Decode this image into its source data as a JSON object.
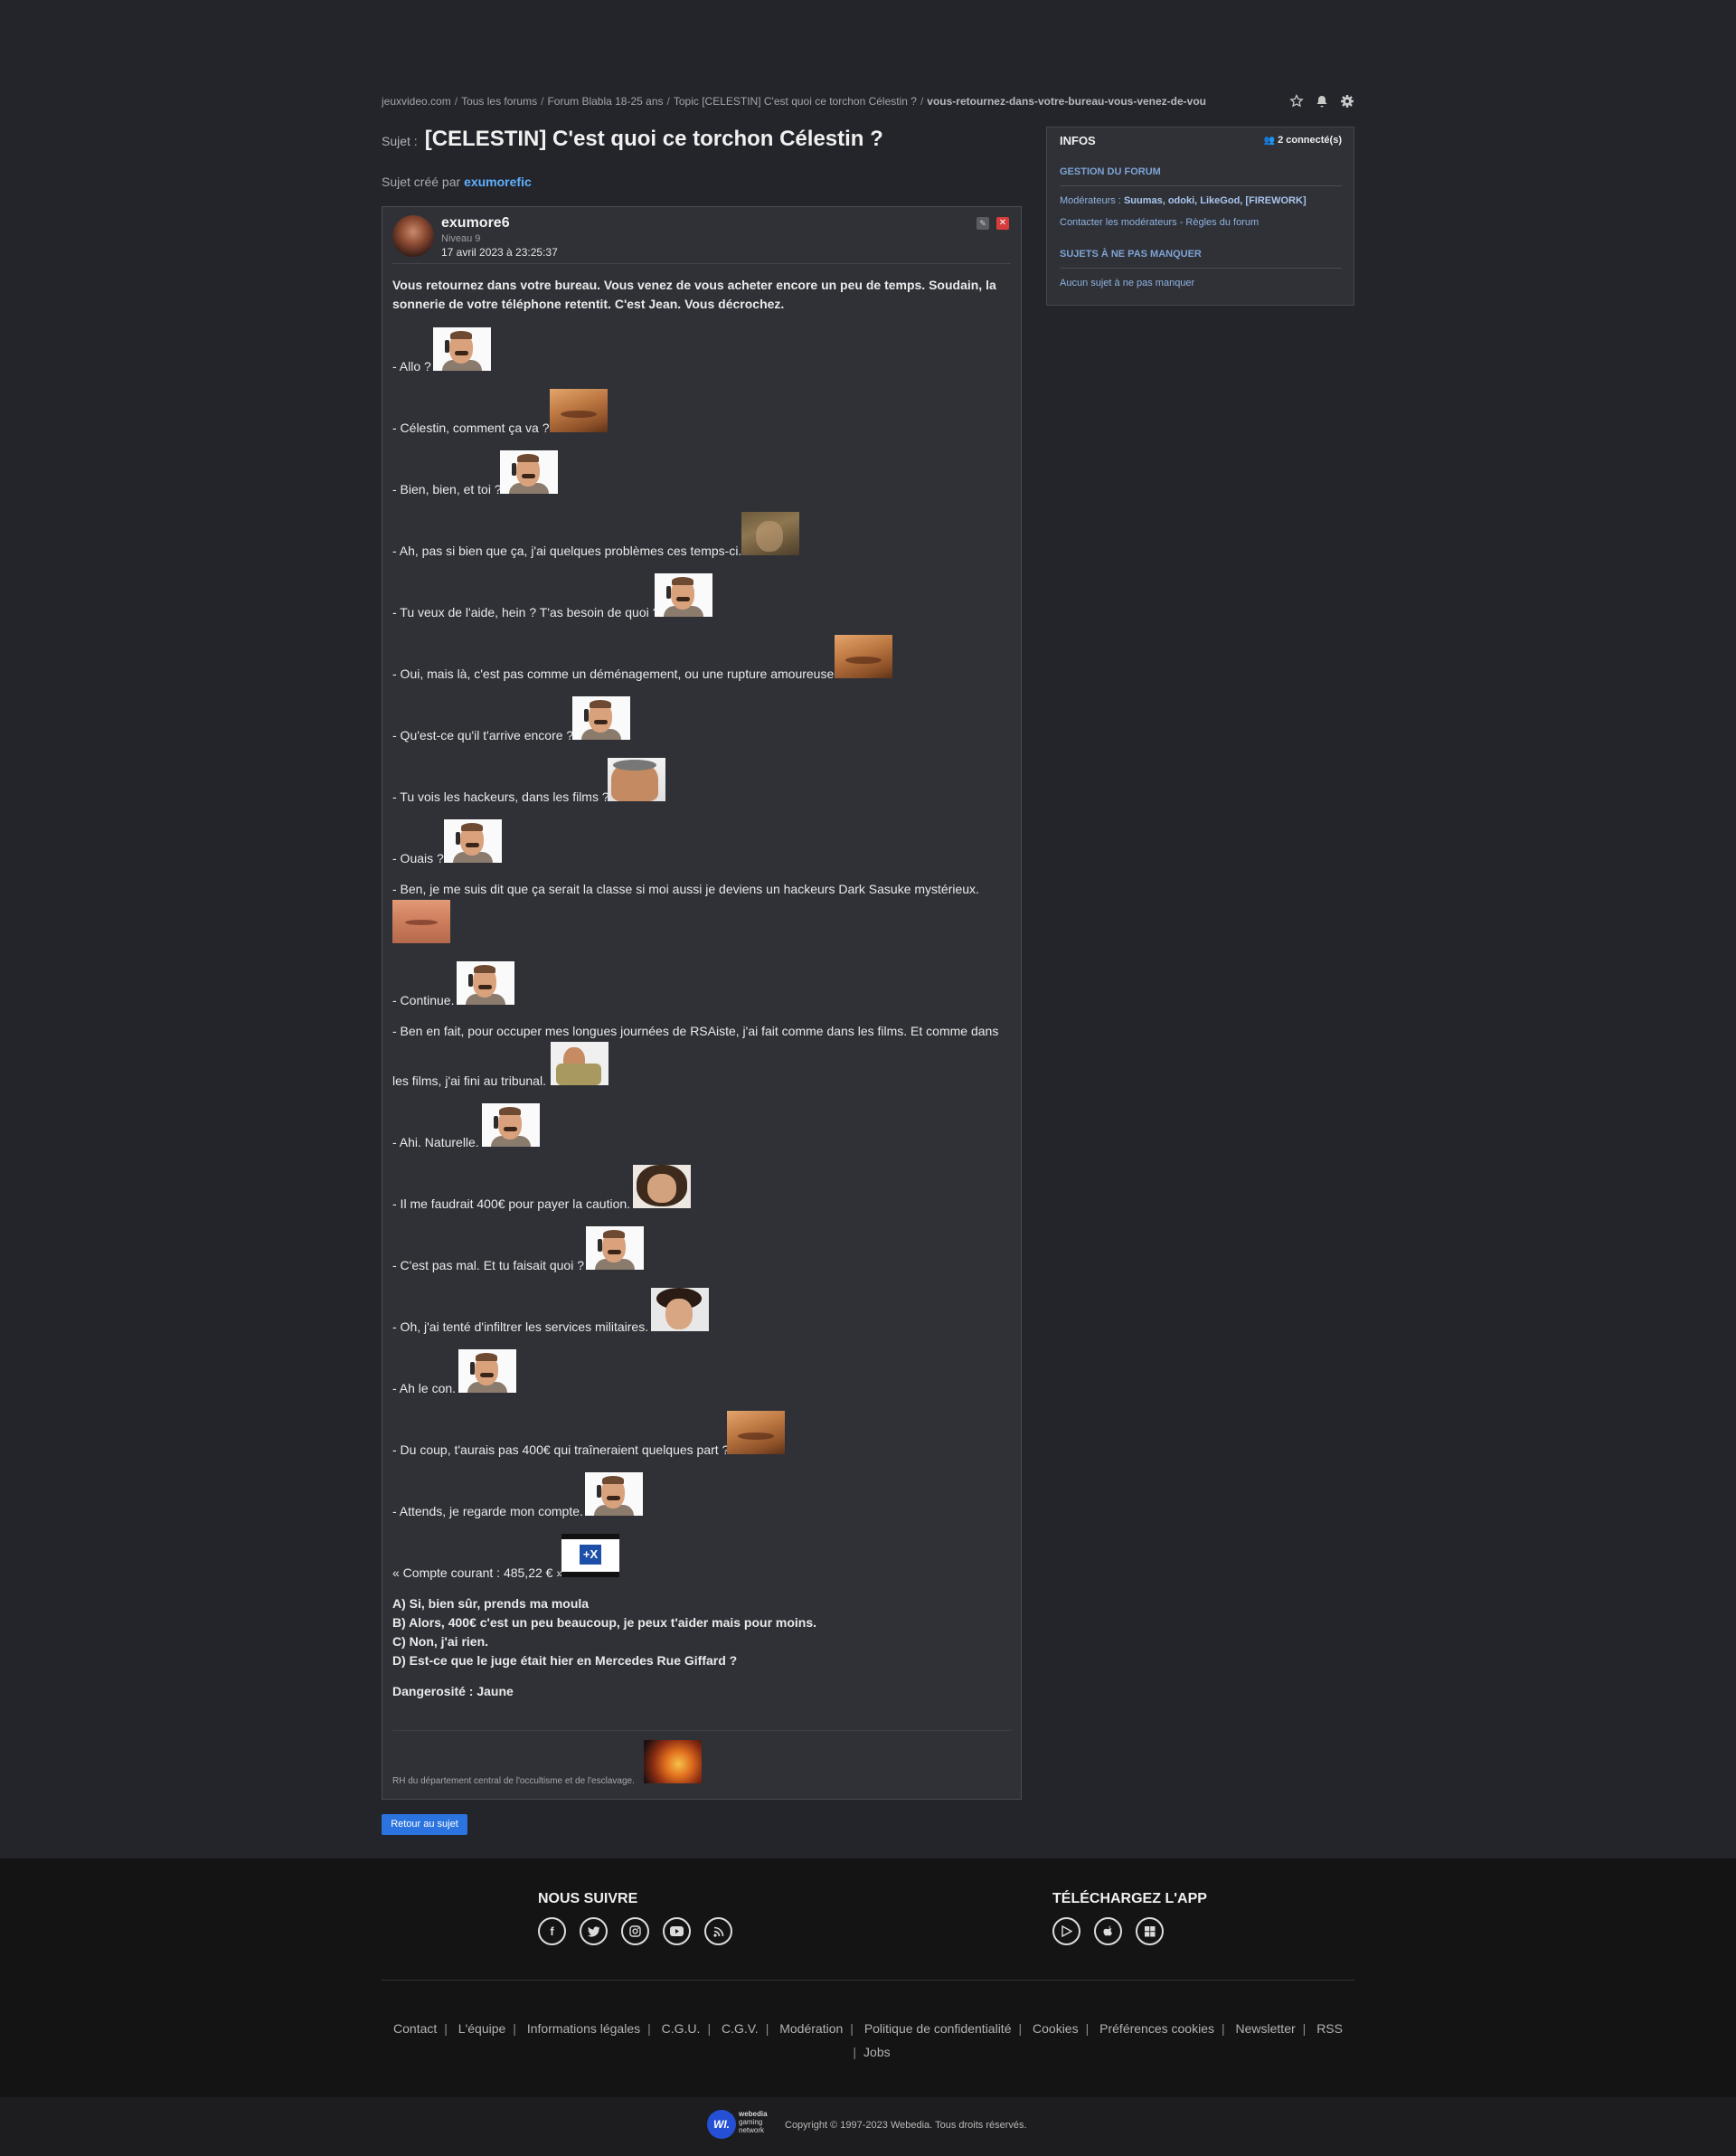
{
  "breadcrumb": {
    "items": [
      "jeuxvideo.com",
      "Tous les forums",
      "Forum Blabla 18-25 ans",
      "Topic [CELESTIN] C'est quoi ce torchon Célestin ?"
    ],
    "slug": "vous-retournez-dans-votre-bureau-vous-venez-de-vou",
    "separator": "/"
  },
  "topic": {
    "prefix": "Sujet :",
    "title": "[CELESTIN] C'est quoi ce torchon Célestin ?",
    "created_by_label": "Sujet créé par",
    "creator": "exumorefic"
  },
  "post": {
    "author": "exumore6",
    "level": "Niveau 9",
    "date": "17 avril 2023 à 23:25:37",
    "intro_1": "Vous retournez dans votre bureau. Vous venez de vous acheter encore un peu de temps. Soudain, la",
    "intro_2": "sonnerie de votre téléphone retentit. C'est Jean. Vous décrochez.",
    "lines": [
      "- Allo ?",
      "- Célestin, comment ça va ?",
      "- Bien, bien, et toi ?",
      "- Ah, pas si bien que ça, j'ai quelques problèmes ces temps-ci.",
      "- Tu veux de l'aide, hein ? T'as besoin de quoi ?",
      "- Oui, mais là, c'est pas comme un déménagement, ou une rupture amoureuse.",
      "- Qu'est-ce qu'il t'arrive encore ?",
      "- Tu vois les hackeurs, dans les films ?",
      "- Ouais ?",
      "- Ben, je me suis dit que ça serait la classe si moi aussi je deviens un hackeurs Dark Sasuke mystérieux.",
      "- Continue.",
      "- Ben en fait, pour occuper mes longues journées de RSAiste, j'ai fait comme dans les films. Et comme dans",
      "les films, j'ai fini au tribunal.",
      "- Ahi. Naturelle.",
      "- Il me faudrait 400€ pour payer la caution.",
      "- C'est pas mal. Et tu faisait quoi ?",
      "- Oh, j'ai tenté d'infiltrer les services militaires.",
      "- Ah le con.",
      "- Du coup, t'aurais pas 400€ qui traîneraient quelques part ?",
      "- Attends, je regarde mon compte.",
      "« Compte courant : 485,22 € »"
    ],
    "choices": [
      "A) Si, bien sûr, prends ma moula",
      "B) Alors, 400€ c'est un peu beaucoup, je peux t'aider mais pour moins.",
      "C) Non, j'ai rien.",
      "D) Est-ce que le juge était hier en Mercedes Rue Giffard ?"
    ],
    "danger": "Dangerosité : Jaune",
    "signature": "RH du département central de l'occultisme et de l'esclavage.",
    "bank_logo": "+X"
  },
  "sidebar": {
    "title": "INFOS",
    "connected": "2 connecté(s)",
    "gestion_title": "GESTION DU FORUM",
    "moderators_label": "Modérateurs :",
    "moderators": "Suumas, odoki, LikeGod, [FIREWORK]",
    "contact": "Contacter les modérateurs",
    "rules": "Règles du forum",
    "link_sep": "-",
    "sujets_title": "SUJETS À NE PAS MANQUER",
    "sujets_none": "Aucun sujet à ne pas manquer"
  },
  "back_button": "Retour au sujet",
  "footer": {
    "follow_title": "NOUS SUIVRE",
    "app_title": "TÉLÉCHARGEZ L'APP",
    "social_icons": [
      "facebook-icon",
      "twitter-icon",
      "instagram-icon",
      "youtube-icon",
      "rss-icon"
    ],
    "app_icons": [
      "google-play-icon",
      "apple-icon",
      "windows-icon"
    ],
    "links_row1": [
      "Contact",
      "L'équipe",
      "Informations légales",
      "C.G.U.",
      "C.G.V.",
      "Modération",
      "Politique de confidentialité",
      "Cookies",
      "Préférences cookies",
      "Newsletter",
      "RSS"
    ],
    "links_row2": [
      "Jobs"
    ],
    "link_separator": "|",
    "brand_logo": "WI.",
    "brand_lines": [
      "webedia",
      "gaming",
      "network"
    ],
    "copyright": "Copyright © 1997-2023 Webedia. Tous droits réservés."
  },
  "colors": {
    "background": "#24252a",
    "panel": "#2f3137",
    "accent": "#2b74e0",
    "link": "#5fb0ff",
    "delete": "#d73c3c"
  }
}
